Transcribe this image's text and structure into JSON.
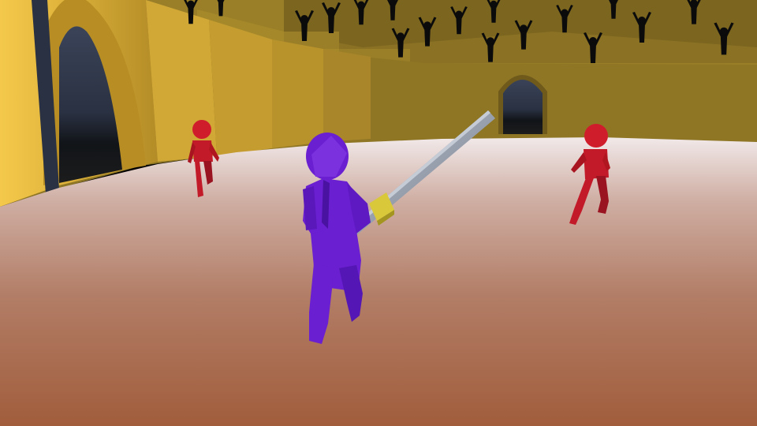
{
  "scene": {
    "type": "arena-sword-fight",
    "view": "third-person",
    "colors": {
      "sky_wall_dark": "#7a6620",
      "upper_stands": "#8f7626",
      "wall_light": "#f2c64a",
      "wall_mid": "#d9ad35",
      "wall_shadow": "#b89026",
      "archway": "#2b3548",
      "floor_far": "#e9dede",
      "floor_mid": "#b58a78",
      "floor_near": "#a0603e",
      "player": "#6a1fd0",
      "player_shadow": "#4a12a0",
      "enemy": "#d01d2c",
      "enemy_shadow": "#9a1320",
      "blade": "#8f97a6",
      "blade_edge": "#b9c0cc",
      "hilt": "#d9c93a",
      "crowd": "#0b0b0b"
    },
    "player": {
      "label": "player-character",
      "weapon": "sword",
      "color_name": "purple"
    },
    "enemies": [
      {
        "label": "enemy-left",
        "color_name": "red"
      },
      {
        "label": "enemy-right",
        "color_name": "red"
      }
    ],
    "crowd_count": 17,
    "archways": 2
  }
}
